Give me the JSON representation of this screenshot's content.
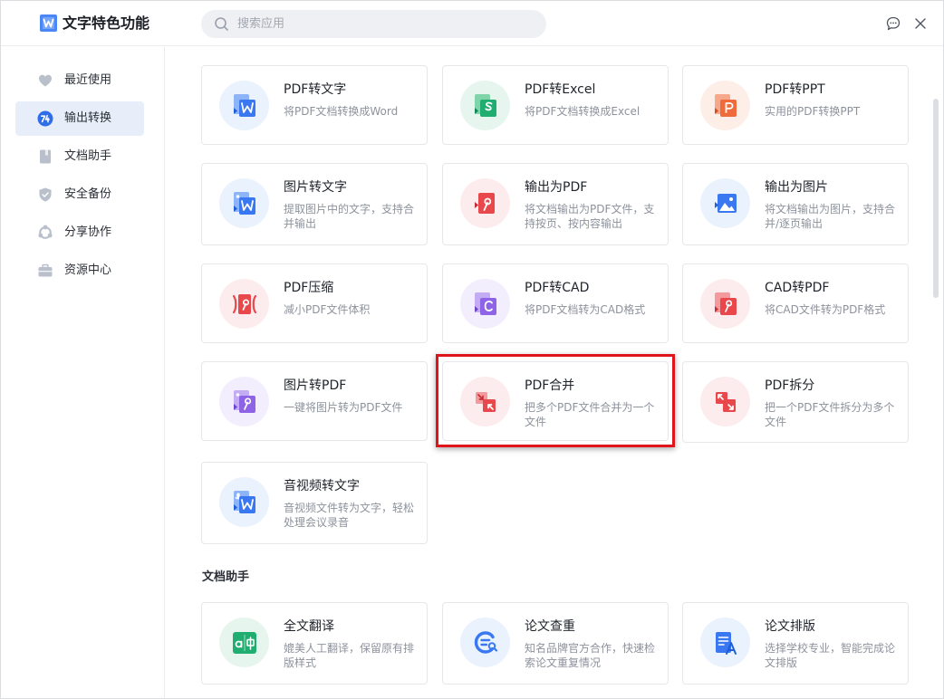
{
  "app": {
    "title": "文字特色功能"
  },
  "search": {
    "placeholder": "搜索应用"
  },
  "sidebar": {
    "items": [
      {
        "label": "最近使用",
        "icon": "heart-icon",
        "active": false
      },
      {
        "label": "输出转换",
        "icon": "convert-icon",
        "active": true
      },
      {
        "label": "文档助手",
        "icon": "document-icon",
        "active": false
      },
      {
        "label": "安全备份",
        "icon": "shield-icon",
        "active": false
      },
      {
        "label": "分享协作",
        "icon": "share-icon",
        "active": false
      },
      {
        "label": "资源中心",
        "icon": "briefcase-icon",
        "active": false
      }
    ]
  },
  "convert": {
    "cards": [
      {
        "title": "PDF转文字",
        "desc": "将PDF文档转换成Word",
        "icon": "pdf-to-word-icon"
      },
      {
        "title": "PDF转Excel",
        "desc": "将PDF文档转换成Excel",
        "icon": "pdf-to-excel-icon"
      },
      {
        "title": "PDF转PPT",
        "desc": "实用的PDF转换PPT",
        "icon": "pdf-to-ppt-icon"
      },
      {
        "title": "图片转文字",
        "desc": "提取图片中的文字，支持合并输出",
        "icon": "image-to-word-icon"
      },
      {
        "title": "输出为PDF",
        "desc": "将文档输出为PDF文件，支持按页、按内容输出",
        "icon": "export-pdf-icon"
      },
      {
        "title": "输出为图片",
        "desc": "将文档输出为图片，支持合并/逐页输出",
        "icon": "export-image-icon"
      },
      {
        "title": "PDF压缩",
        "desc": "减小PDF文件体积",
        "icon": "pdf-compress-icon"
      },
      {
        "title": "PDF转CAD",
        "desc": "将PDF文档转为CAD格式",
        "icon": "pdf-to-cad-icon"
      },
      {
        "title": "CAD转PDF",
        "desc": "将CAD文件转为PDF格式",
        "icon": "cad-to-pdf-icon"
      },
      {
        "title": "图片转PDF",
        "desc": "一键将图片转为PDF文件",
        "icon": "image-to-pdf-icon"
      },
      {
        "title": "PDF合并",
        "desc": "把多个PDF文件合并为一个文件",
        "icon": "pdf-merge-icon"
      },
      {
        "title": "PDF拆分",
        "desc": "把一个PDF文件拆分为多个文件",
        "icon": "pdf-split-icon"
      },
      {
        "title": "音视频转文字",
        "desc": "音视频文件转为文字，轻松处理会议录音",
        "icon": "audio-to-word-icon"
      }
    ]
  },
  "assistant": {
    "title": "文档助手",
    "cards": [
      {
        "title": "全文翻译",
        "desc": "媲美人工翻译，保留原有排版样式",
        "icon": "translate-icon"
      },
      {
        "title": "论文查重",
        "desc": "知名品牌官方合作，快速检索论文重复情况",
        "icon": "plagiarism-check-icon"
      },
      {
        "title": "论文排版",
        "desc": "选择学校专业，智能完成论文排版",
        "icon": "thesis-format-icon"
      }
    ]
  },
  "colors": {
    "accent": "#3a78f2",
    "red": "#e8474c",
    "green": "#1fae70",
    "orange": "#ef6b3b",
    "purple": "#8e63e6",
    "highlight": "#e0141b"
  }
}
